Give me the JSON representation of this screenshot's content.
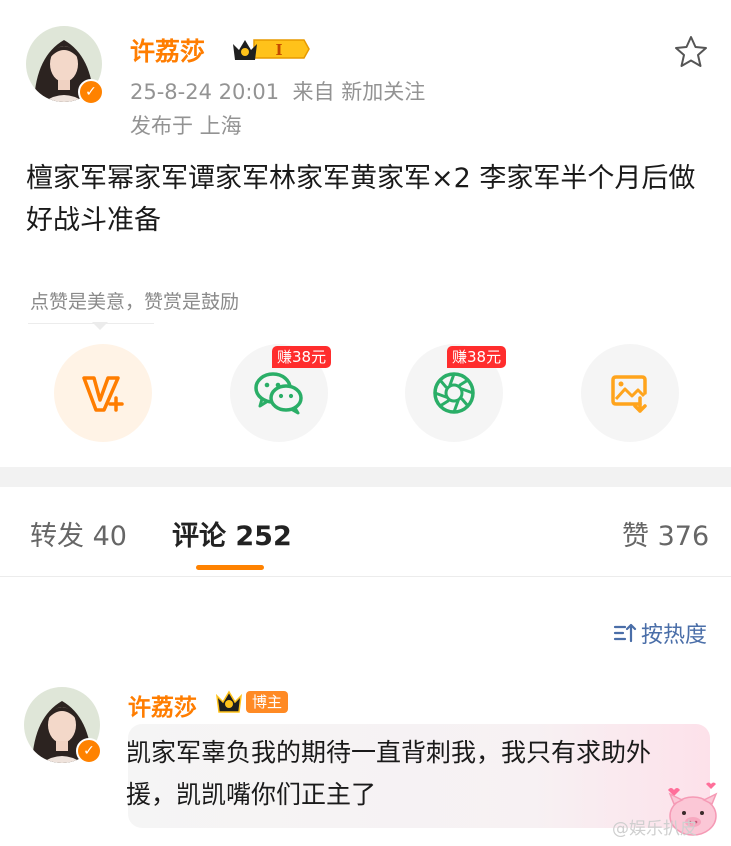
{
  "post": {
    "author": "许荔莎",
    "level": "I",
    "timestamp": "25-8-24 20:01",
    "source": "来自 新加关注",
    "location": "发布于 上海",
    "text": "檀家军幂家军谭家军林家军黄家军×2 李家军半个月后做好战斗准备"
  },
  "reward": {
    "hint": "点赞是美意，赞赏是鼓励",
    "earn_badge_1": "赚38元",
    "earn_badge_2": "赚38元"
  },
  "tabs": {
    "repost": "转发 40",
    "comment": "评论 252",
    "like": "赞 376"
  },
  "sort": {
    "label": "按热度"
  },
  "comment": {
    "author": "许荔莎",
    "tag": "博主",
    "text": "凯家军辜负我的期待一直背刺我，我只有求助外援，凯凯嘴你们正主了"
  },
  "watermark": "@娱乐扒皮",
  "colors": {
    "accent": "#ff8200",
    "wechat": "#2aae67",
    "earn": "#ff2d2d"
  },
  "icons": [
    "star-icon",
    "v-plus-icon",
    "wechat-icon",
    "moments-icon",
    "save-image-icon",
    "sort-icon",
    "crown-icon"
  ]
}
